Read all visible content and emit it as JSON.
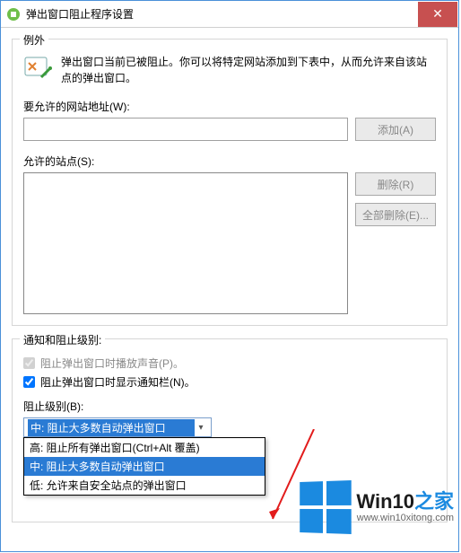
{
  "window": {
    "title": "弹出窗口阻止程序设置",
    "close_glyph": "✕"
  },
  "exceptions": {
    "group_title": "例外",
    "description": "弹出窗口当前已被阻止。你可以将特定网站添加到下表中，从而允许来自该站点的弹出窗口。",
    "address_label": "要允许的网站地址(W):",
    "address_value": "",
    "add_label": "添加(A)",
    "sites_label": "允许的站点(S):",
    "remove_label": "删除(R)",
    "remove_all_label": "全部删除(E)..."
  },
  "notify": {
    "group_title": "通知和阻止级别:",
    "sound_label": "阻止弹出窗口时播放声音(P)。",
    "sound_checked": true,
    "sound_disabled": true,
    "bar_label": "阻止弹出窗口时显示通知栏(N)。",
    "bar_checked": true
  },
  "level": {
    "label": "阻止级别(B):",
    "selected": "中: 阻止大多数自动弹出窗口",
    "options": [
      "高: 阻止所有弹出窗口(Ctrl+Alt 覆盖)",
      "中: 阻止大多数自动弹出窗口",
      "低: 允许来自安全站点的弹出窗口"
    ],
    "selected_index": 1
  },
  "brand": {
    "main_a": "Win10",
    "main_b": "之家",
    "sub": "www.win10xitong.com"
  }
}
